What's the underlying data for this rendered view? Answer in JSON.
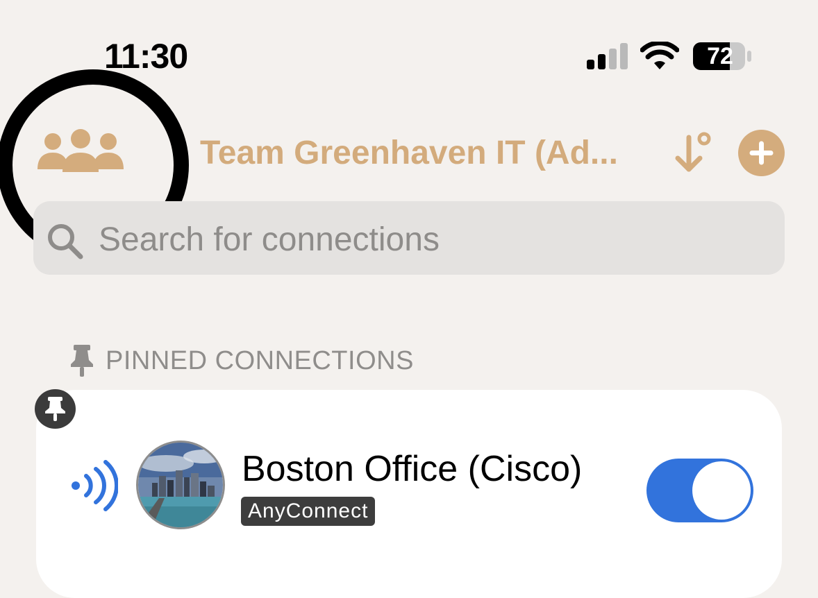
{
  "status_bar": {
    "time": "11:30",
    "battery_level": "72",
    "signal_bars": 2,
    "signal_bars_total": 4
  },
  "header": {
    "team_title": "Team Greenhaven IT (Ad...",
    "team_icon": "people-group-icon",
    "sort_icon": "sort-arrow-icon",
    "add_icon": "plus-circle-icon"
  },
  "search": {
    "placeholder": "Search for connections",
    "value": "",
    "icon": "search-icon"
  },
  "pinned_section": {
    "title": "PINNED CONNECTIONS",
    "icon": "pin-icon"
  },
  "connections": [
    {
      "name": "Boston Office (Cisco)",
      "protocol": "AnyConnect",
      "status_icon": "broadcast-waves-icon",
      "pinned": true,
      "enabled": true
    }
  ],
  "colors": {
    "accent": "#d3ab7c",
    "toggle_on": "#3273dc",
    "background": "#f4f1ee",
    "focus_ring": "#000000"
  }
}
